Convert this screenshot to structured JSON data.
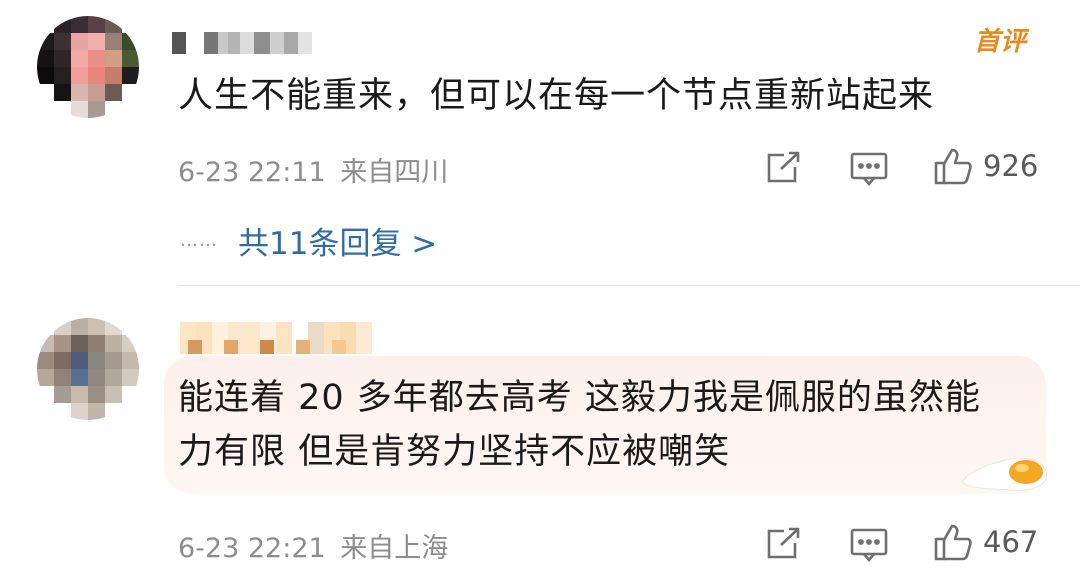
{
  "comments": [
    {
      "author": "",
      "badge": "首评",
      "text": "人生不能重来，但可以在每一个节点重新站起来",
      "time": "6-23 22:11",
      "location": "来自四川",
      "like_count": "926",
      "replies_dots": "……",
      "replies_label": "共11条回复 >"
    },
    {
      "author": "",
      "text_line1": "能连着 20 多年都去高考 这毅力我是佩服的虽然能",
      "text_line2": "力有限 但是肯努力坚持不应被嘲笑",
      "time": "6-23 22:21",
      "location": "来自上海",
      "like_count": "467"
    }
  ],
  "icons": [
    "share-icon",
    "comment-icon",
    "like-icon",
    "egg-decoration-icon"
  ],
  "colors": {
    "link": "#2f6da6",
    "badge": "#e88a1e",
    "meta": "#8d8d8d"
  }
}
